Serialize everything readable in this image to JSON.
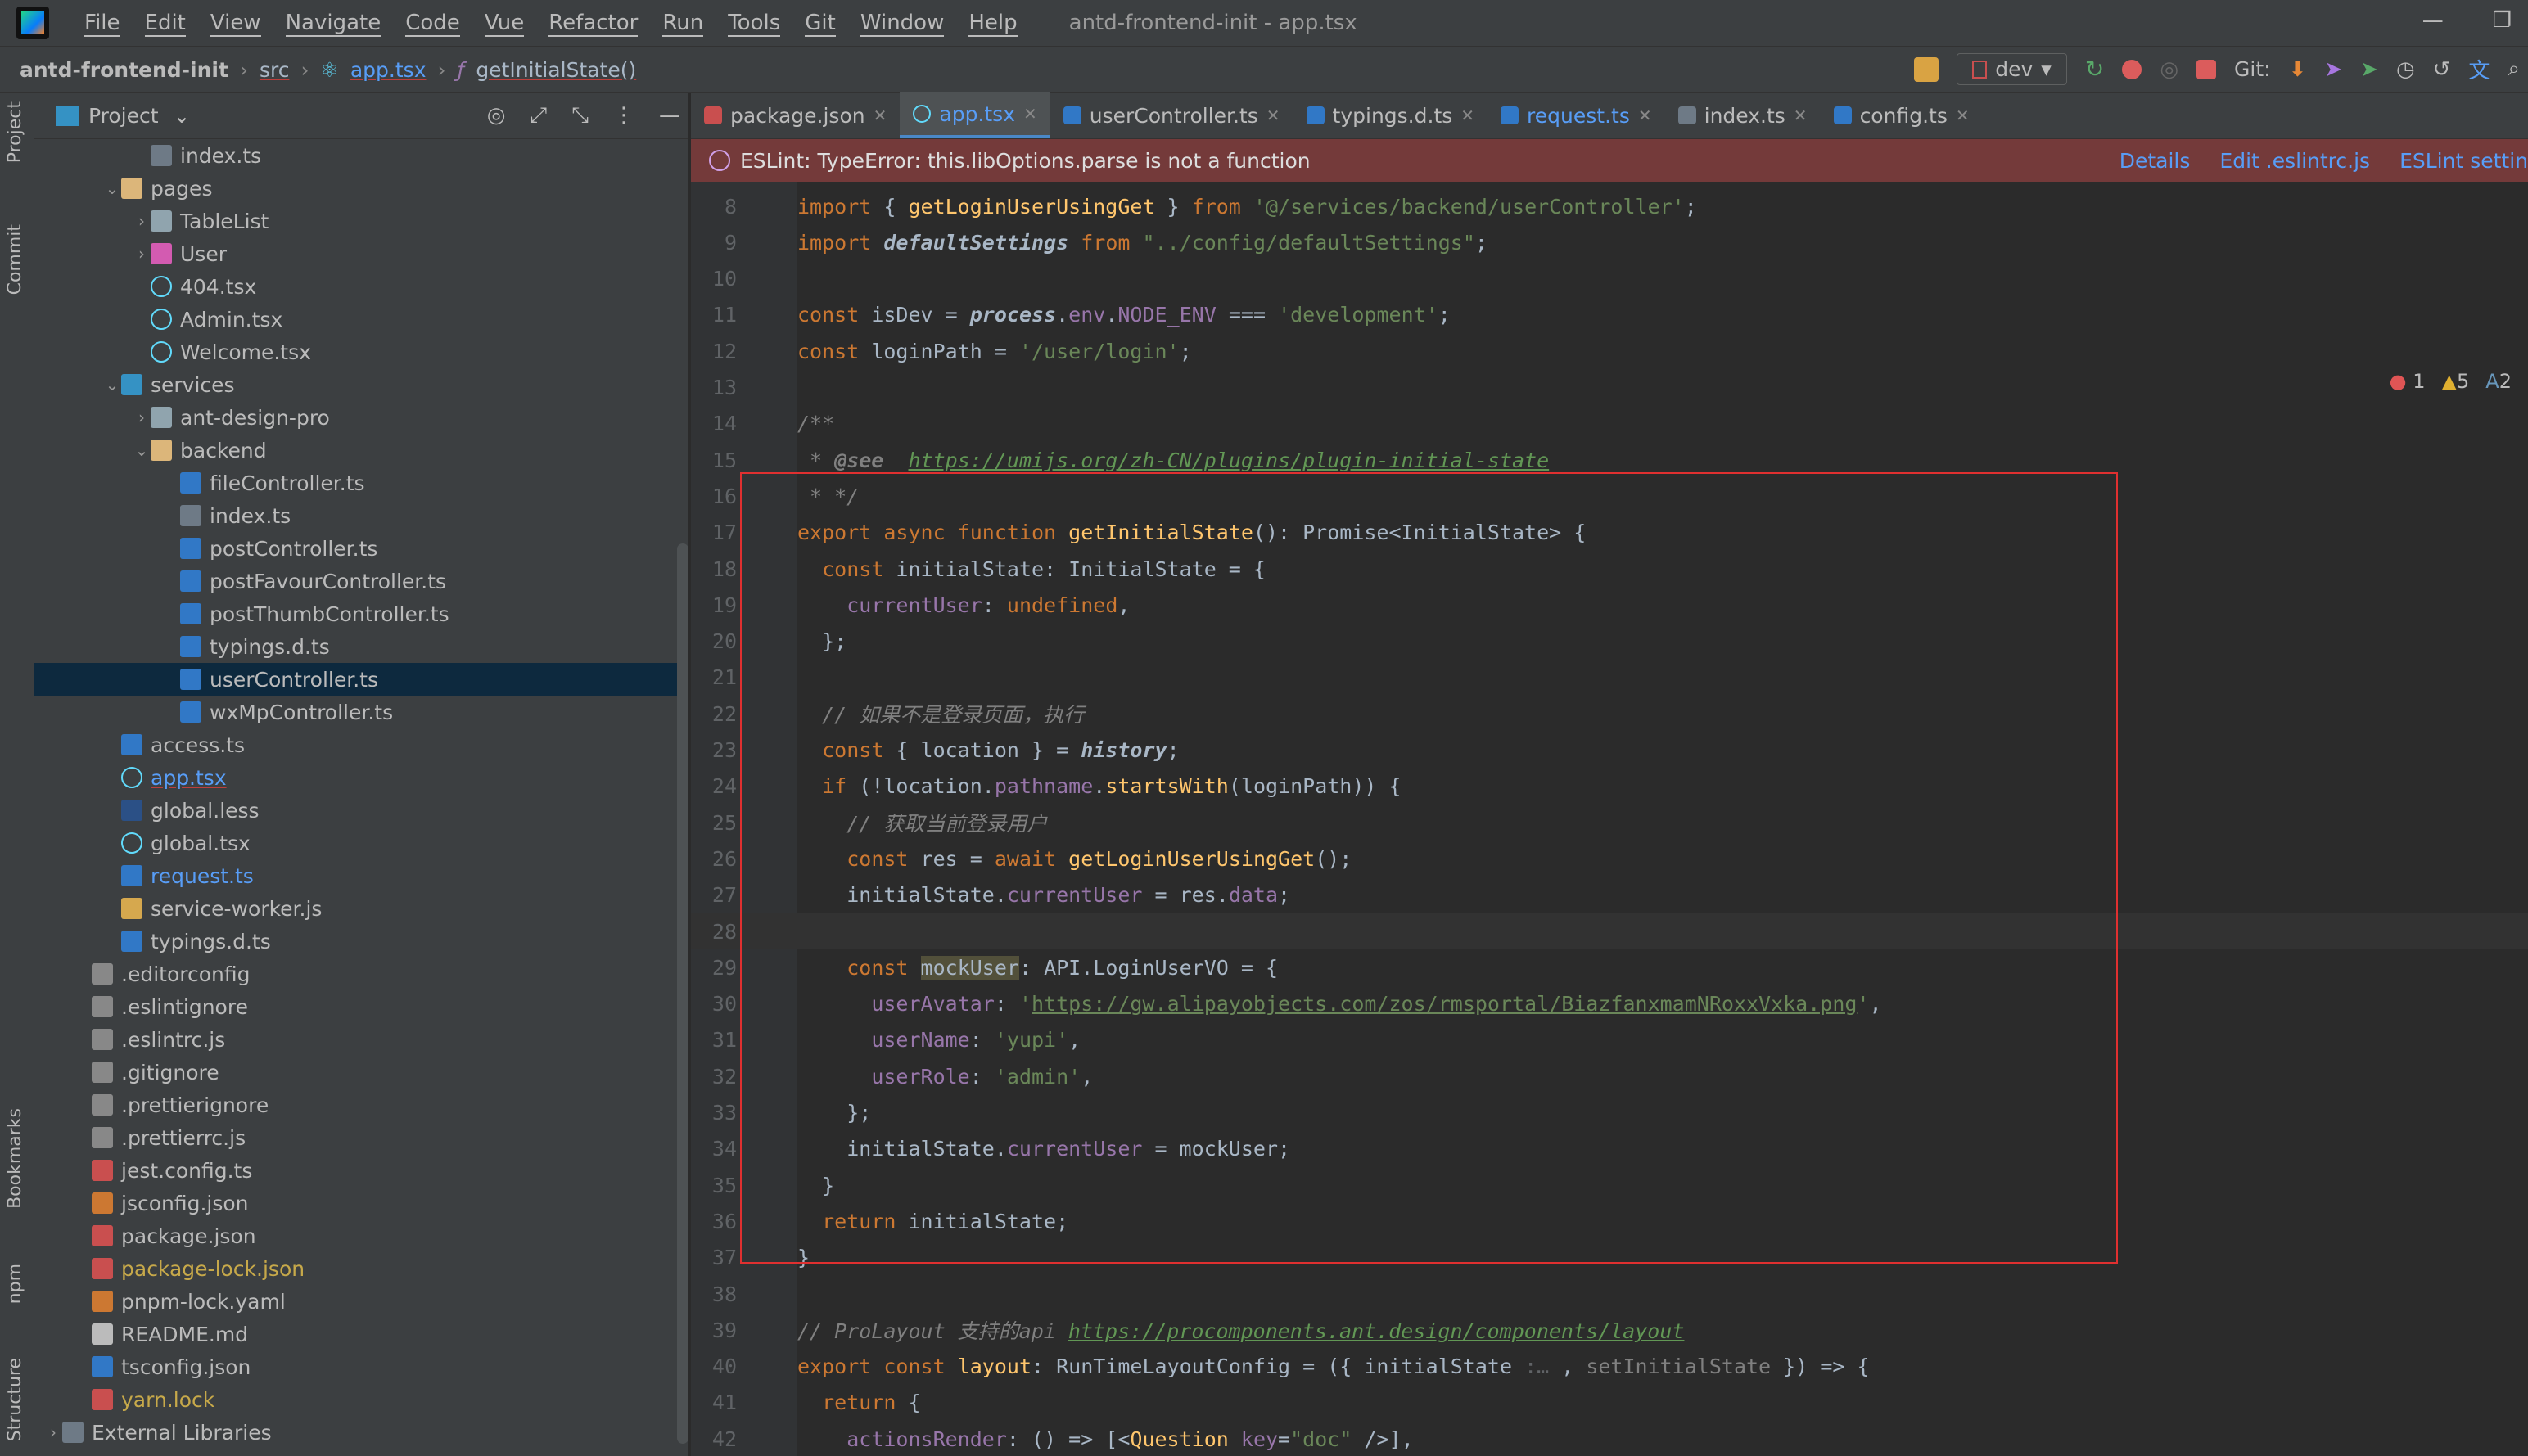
{
  "menubar": {
    "items": [
      "File",
      "Edit",
      "View",
      "Navigate",
      "Code",
      "Vue",
      "Refactor",
      "Run",
      "Tools",
      "Git",
      "Window",
      "Help"
    ],
    "title": "antd-frontend-init - app.tsx"
  },
  "navbar": {
    "project": "antd-frontend-init",
    "folder": "src",
    "file": "app.tsx",
    "symbol": "getInitialState()",
    "branch": "dev",
    "git_label": "Git:"
  },
  "left_strip": {
    "project": "Project",
    "commit": "Commit",
    "bookmarks": "Bookmarks",
    "npm": "npm",
    "structure": "Structure"
  },
  "project_panel": {
    "title": "Project",
    "tree": [
      {
        "indent": 3,
        "arrow": "",
        "icon": "list",
        "label": "index.ts"
      },
      {
        "indent": 2,
        "arrow": "v",
        "icon": "folder-o",
        "label": "pages"
      },
      {
        "indent": 3,
        "arrow": ">",
        "icon": "folder",
        "label": "TableList"
      },
      {
        "indent": 3,
        "arrow": ">",
        "icon": "folder-p",
        "label": "User"
      },
      {
        "indent": 3,
        "arrow": "",
        "icon": "react",
        "label": "404.tsx"
      },
      {
        "indent": 3,
        "arrow": "",
        "icon": "react",
        "label": "Admin.tsx"
      },
      {
        "indent": 3,
        "arrow": "",
        "icon": "react",
        "label": "Welcome.tsx"
      },
      {
        "indent": 2,
        "arrow": "v",
        "icon": "folder-b",
        "label": "services"
      },
      {
        "indent": 3,
        "arrow": ">",
        "icon": "folder",
        "label": "ant-design-pro"
      },
      {
        "indent": 3,
        "arrow": "v",
        "icon": "folder-o",
        "label": "backend"
      },
      {
        "indent": 4,
        "arrow": "",
        "icon": "ts",
        "label": "fileController.ts"
      },
      {
        "indent": 4,
        "arrow": "",
        "icon": "list",
        "label": "index.ts"
      },
      {
        "indent": 4,
        "arrow": "",
        "icon": "ts",
        "label": "postController.ts"
      },
      {
        "indent": 4,
        "arrow": "",
        "icon": "ts",
        "label": "postFavourController.ts"
      },
      {
        "indent": 4,
        "arrow": "",
        "icon": "ts",
        "label": "postThumbController.ts"
      },
      {
        "indent": 4,
        "arrow": "",
        "icon": "ts",
        "label": "typings.d.ts"
      },
      {
        "indent": 4,
        "arrow": "",
        "icon": "ts",
        "label": "userController.ts",
        "selected": true
      },
      {
        "indent": 4,
        "arrow": "",
        "icon": "ts",
        "label": "wxMpController.ts"
      },
      {
        "indent": 2,
        "arrow": "",
        "icon": "ts",
        "label": "access.ts"
      },
      {
        "indent": 2,
        "arrow": "",
        "icon": "react",
        "label": "app.tsx",
        "color": "#589df6",
        "underline": true
      },
      {
        "indent": 2,
        "arrow": "",
        "icon": "less",
        "label": "global.less"
      },
      {
        "indent": 2,
        "arrow": "",
        "icon": "react",
        "label": "global.tsx"
      },
      {
        "indent": 2,
        "arrow": "",
        "icon": "ts",
        "label": "request.ts",
        "color": "#589df6"
      },
      {
        "indent": 2,
        "arrow": "",
        "icon": "js",
        "label": "service-worker.js"
      },
      {
        "indent": 2,
        "arrow": "",
        "icon": "ts",
        "label": "typings.d.ts"
      },
      {
        "indent": 1,
        "arrow": "",
        "icon": "cfg",
        "label": ".editorconfig"
      },
      {
        "indent": 1,
        "arrow": "",
        "icon": "cfg",
        "label": ".eslintignore"
      },
      {
        "indent": 1,
        "arrow": "",
        "icon": "cfg",
        "label": ".eslintrc.js"
      },
      {
        "indent": 1,
        "arrow": "",
        "icon": "cfg",
        "label": ".gitignore"
      },
      {
        "indent": 1,
        "arrow": "",
        "icon": "cfg",
        "label": ".prettierignore"
      },
      {
        "indent": 1,
        "arrow": "",
        "icon": "cfg",
        "label": ".prettierrc.js"
      },
      {
        "indent": 1,
        "arrow": "",
        "icon": "lock",
        "label": "jest.config.ts"
      },
      {
        "indent": 1,
        "arrow": "",
        "icon": "json",
        "label": "jsconfig.json"
      },
      {
        "indent": 1,
        "arrow": "",
        "icon": "lock",
        "label": "package.json"
      },
      {
        "indent": 1,
        "arrow": "",
        "icon": "lock",
        "label": "package-lock.json",
        "color": "#c7a94a"
      },
      {
        "indent": 1,
        "arrow": "",
        "icon": "json",
        "label": "pnpm-lock.yaml"
      },
      {
        "indent": 1,
        "arrow": "",
        "icon": "md",
        "label": "README.md"
      },
      {
        "indent": 1,
        "arrow": "",
        "icon": "ts",
        "label": "tsconfig.json"
      },
      {
        "indent": 1,
        "arrow": "",
        "icon": "lock",
        "label": "yarn.lock",
        "color": "#c7a94a"
      },
      {
        "indent": 0,
        "arrow": ">",
        "icon": "list",
        "label": "External Libraries"
      }
    ]
  },
  "tabs": [
    {
      "label": "package.json",
      "icon": "#c94f4f",
      "active": false,
      "blue": false
    },
    {
      "label": "app.tsx",
      "icon": "#61dafb",
      "active": true,
      "blue": true
    },
    {
      "label": "userController.ts",
      "icon": "#3178c6",
      "active": false,
      "blue": false
    },
    {
      "label": "typings.d.ts",
      "icon": "#3178c6",
      "active": false,
      "blue": false
    },
    {
      "label": "request.ts",
      "icon": "#3178c6",
      "active": false,
      "blue": true
    },
    {
      "label": "index.ts",
      "icon": "#6e7a86",
      "active": false,
      "blue": false
    },
    {
      "label": "config.ts",
      "icon": "#3178c6",
      "active": false,
      "blue": false
    }
  ],
  "eslint_banner": {
    "message": "ESLint: TypeError: this.libOptions.parse is not a function",
    "actions": [
      "Details",
      "Edit .eslintrc.js",
      "ESLint settin"
    ]
  },
  "indicators": {
    "errors": "1",
    "warnings": "5",
    "typos": "2"
  },
  "code_lines": [
    {
      "n": "8",
      "html": "<span class='kw'>import</span> { <span class='fn'>getLoginUserUsingGet</span> } <span class='kw'>from</span> <span class='str'>'@/services/backend/userController'</span>;"
    },
    {
      "n": "9",
      "html": "<span class='kw'>import</span> <span class='it'>defaultSettings</span> <span class='kw'>from</span> <span class='str'>\"../config/defaultSettings\"</span>;"
    },
    {
      "n": "10",
      "html": ""
    },
    {
      "n": "11",
      "html": "<span class='kw'>const</span> isDev = <span class='it'>process</span>.<span class='prop'>env</span>.<span class='prop'>NODE_ENV</span> === <span class='str'>'development'</span>;"
    },
    {
      "n": "12",
      "html": "<span class='kw'>const</span> loginPath = <span class='str'>'/user/login'</span>;"
    },
    {
      "n": "13",
      "html": ""
    },
    {
      "n": "14",
      "html": "<span class='cm'>/**</span>"
    },
    {
      "n": "15",
      "html": "<span class='cm'> * <b>@see</b>  </span><span class='cmurl'>https://umijs.org/zh-CN/plugins/plugin-initial-state</span>"
    },
    {
      "n": "16",
      "html": "<span class='cm'> * */</span>"
    },
    {
      "n": "17",
      "html": "<span class='kw'>export async function</span> <span class='fn'>getInitialState</span>(): Promise&lt;InitialState&gt; {"
    },
    {
      "n": "18",
      "html": "  <span class='kw'>const</span> initialState: InitialState = {"
    },
    {
      "n": "19",
      "html": "    <span class='prop'>currentUser</span>: <span class='kw'>undefined</span>,"
    },
    {
      "n": "20",
      "html": "  };"
    },
    {
      "n": "21",
      "html": ""
    },
    {
      "n": "22",
      "html": "  <span class='cm'>// 如果不是登录页面，执行</span>"
    },
    {
      "n": "23",
      "html": "  <span class='kw'>const</span> { location } = <span class='it'>history</span>;"
    },
    {
      "n": "24",
      "html": "  <span class='kw'>if</span> (!location.<span class='prop'>pathname</span>.<span class='fn'>startsWith</span>(loginPath)) {"
    },
    {
      "n": "25",
      "html": "    <span class='cm'>// 获取当前登录用户</span>"
    },
    {
      "n": "26",
      "html": "    <span class='kw'>const</span> res = <span class='kw'>await</span> <span class='fn'>getLoginUserUsingGet</span>();"
    },
    {
      "n": "27",
      "html": "    initialState.<span class='prop'>currentUser</span> = res.<span class='prop'>data</span>;"
    },
    {
      "n": "28",
      "html": "",
      "current": true
    },
    {
      "n": "29",
      "html": "    <span class='kw'>const</span> <span class='hl'>mockUser</span>: API.LoginUserVO = {"
    },
    {
      "n": "30",
      "html": "      <span class='prop'>userAvatar</span>: <span class='str'>'</span><span class='url'>https://gw.alipayobjects.com/zos/rmsportal/BiazfanxmamNRoxxVxka.png</span><span class='str'>'</span>,"
    },
    {
      "n": "31",
      "html": "      <span class='prop'>userName</span>: <span class='str'>'yupi'</span>,"
    },
    {
      "n": "32",
      "html": "      <span class='prop'>userRole</span>: <span class='str'>'admin'</span>,"
    },
    {
      "n": "33",
      "html": "    };"
    },
    {
      "n": "34",
      "html": "    initialState.<span class='prop'>currentUser</span> = mockUser;"
    },
    {
      "n": "35",
      "html": "  }"
    },
    {
      "n": "36",
      "html": "  <span class='kw'>return</span> initialState;"
    },
    {
      "n": "37",
      "html": "}"
    },
    {
      "n": "38",
      "html": ""
    },
    {
      "n": "39",
      "html": "<span class='cm'>// ProLayout 支持的api </span><span class='cmurl'>https://procomponents.ant.design/components/layout</span>"
    },
    {
      "n": "40",
      "html": "<span class='kw'>export const</span> <span class='fn'>layout</span>: RunTimeLayoutConfig = ({ initialState <span style='color:#606366'>:…</span> , <span style='color:#808080'>setInitialState</span> }) =&gt; {"
    },
    {
      "n": "41",
      "html": "  <span class='kw'>return</span> {"
    },
    {
      "n": "42",
      "html": "    <span class='prop'>actionsRender</span>: () =&gt; [&lt;<span class='fn'>Question</span> <span class='prop'>key</span>=<span class='str'>\"doc\"</span> /&gt;],"
    }
  ]
}
